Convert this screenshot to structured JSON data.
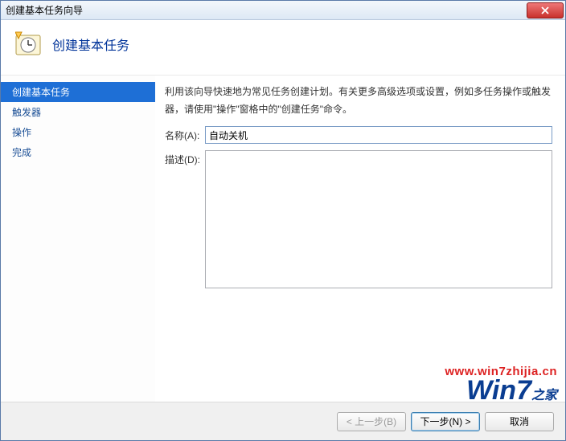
{
  "window": {
    "title": "创建基本任务向导"
  },
  "header": {
    "heading": "创建基本任务"
  },
  "sidebar": {
    "items": [
      {
        "label": "创建基本任务",
        "active": true
      },
      {
        "label": "触发器",
        "active": false
      },
      {
        "label": "操作",
        "active": false
      },
      {
        "label": "完成",
        "active": false
      }
    ]
  },
  "content": {
    "intro": "利用该向导快速地为常见任务创建计划。有关更多高级选项或设置，例如多任务操作或触发器，请使用\"操作\"窗格中的\"创建任务\"命令。",
    "name_label": "名称(A):",
    "name_value": "自动关机",
    "desc_label": "描述(D):",
    "desc_value": ""
  },
  "footer": {
    "back": "< 上一步(B)",
    "next": "下一步(N) >",
    "cancel": "取消"
  },
  "watermark": {
    "url": "www.win7zhijia.cn",
    "logo_main": "Win7",
    "logo_sub": "之家"
  }
}
